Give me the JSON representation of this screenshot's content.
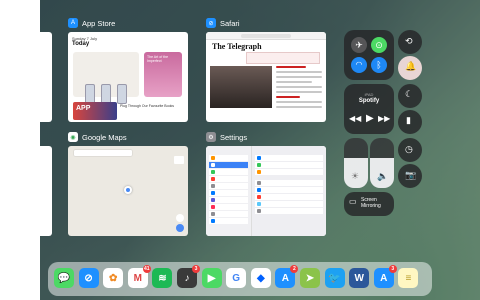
{
  "app_switcher": {
    "cards": [
      {
        "title": "App Store",
        "icon": "app-store-icon"
      },
      {
        "title": "Safari",
        "icon": "safari-icon"
      },
      {
        "title": "Google Maps",
        "icon": "google-maps-icon"
      },
      {
        "title": "Settings",
        "icon": "settings-icon"
      }
    ],
    "app_store_thumb": {
      "date_label": "Sunday 7 July",
      "heading": "Today",
      "promo_caption": "The Art of the Imperfect",
      "bottom_tag": "APP",
      "bottom_caption": "Plug Through Our Favourite Books"
    },
    "safari_thumb": {
      "logo": "The Telegraph"
    }
  },
  "control_center": {
    "media": {
      "source": "iPAD",
      "title": "Spotify"
    },
    "screen_mirroring": "Screen\nMirroring"
  },
  "dock": {
    "apps": [
      {
        "name": "messages-icon",
        "color": "#4cd964",
        "glyph": "💬",
        "badge": ""
      },
      {
        "name": "safari-icon",
        "color": "#1e90ff",
        "glyph": "⊘",
        "badge": ""
      },
      {
        "name": "photos-icon",
        "color": "#ffffff",
        "glyph": "✿",
        "badge": ""
      },
      {
        "name": "gmail-icon",
        "color": "#ffffff",
        "glyph": "M",
        "badge": "41"
      },
      {
        "name": "spotify-icon",
        "color": "#1db954",
        "glyph": "≋",
        "badge": ""
      },
      {
        "name": "music-icon",
        "color": "#3a3a3a",
        "glyph": "♪",
        "badge": "3"
      },
      {
        "name": "facetime-icon",
        "color": "#4cd964",
        "glyph": "▶",
        "badge": ""
      },
      {
        "name": "google-icon",
        "color": "#ffffff",
        "glyph": "G",
        "badge": ""
      },
      {
        "name": "dropbox-icon",
        "color": "#ffffff",
        "glyph": "◆",
        "badge": ""
      },
      {
        "name": "app-store-icon",
        "color": "#1e90ff",
        "glyph": "A",
        "badge": "2"
      },
      {
        "name": "maps-icon",
        "color": "#8bc34a",
        "glyph": "➤",
        "badge": ""
      },
      {
        "name": "twitter-icon",
        "color": "#1da1f2",
        "glyph": "🐦",
        "badge": ""
      },
      {
        "name": "word-icon",
        "color": "#2b579a",
        "glyph": "W",
        "badge": ""
      },
      {
        "name": "app-store-2-icon",
        "color": "#1e90ff",
        "glyph": "A",
        "badge": "3"
      },
      {
        "name": "notes-icon",
        "color": "#fff7c2",
        "glyph": "≡",
        "badge": ""
      }
    ]
  }
}
